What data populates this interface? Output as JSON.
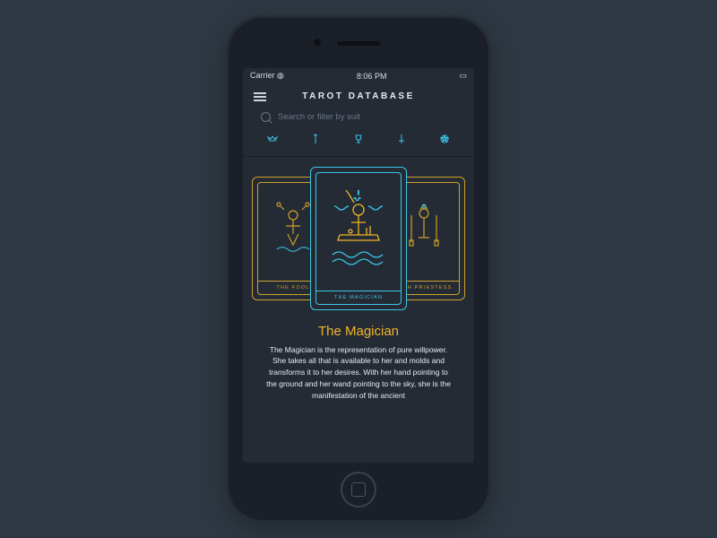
{
  "statusbar": {
    "carrier": "Carrier",
    "time": "8:06 PM"
  },
  "app": {
    "title": "TAROT DATABASE"
  },
  "search": {
    "placeholder": "Search or filter by suit"
  },
  "filters": [
    "crown",
    "wand",
    "cup",
    "sword",
    "pentacle"
  ],
  "cards": {
    "left": {
      "label": "THE FOOL"
    },
    "center": {
      "label": "THE MAGICIAN"
    },
    "right": {
      "label": "HIGH PRIESTESS"
    }
  },
  "detail": {
    "title": "The Magician",
    "description": "The Magician is the representation of pure willpower. She takes all that is available to her and molds and transforms it to her desires. With her hand pointing to the ground and her wand pointing to the sky, she is the manifestation of the ancient"
  },
  "colors": {
    "cyan": "#39c7e6",
    "gold": "#f0b429",
    "bg": "#242b35"
  }
}
